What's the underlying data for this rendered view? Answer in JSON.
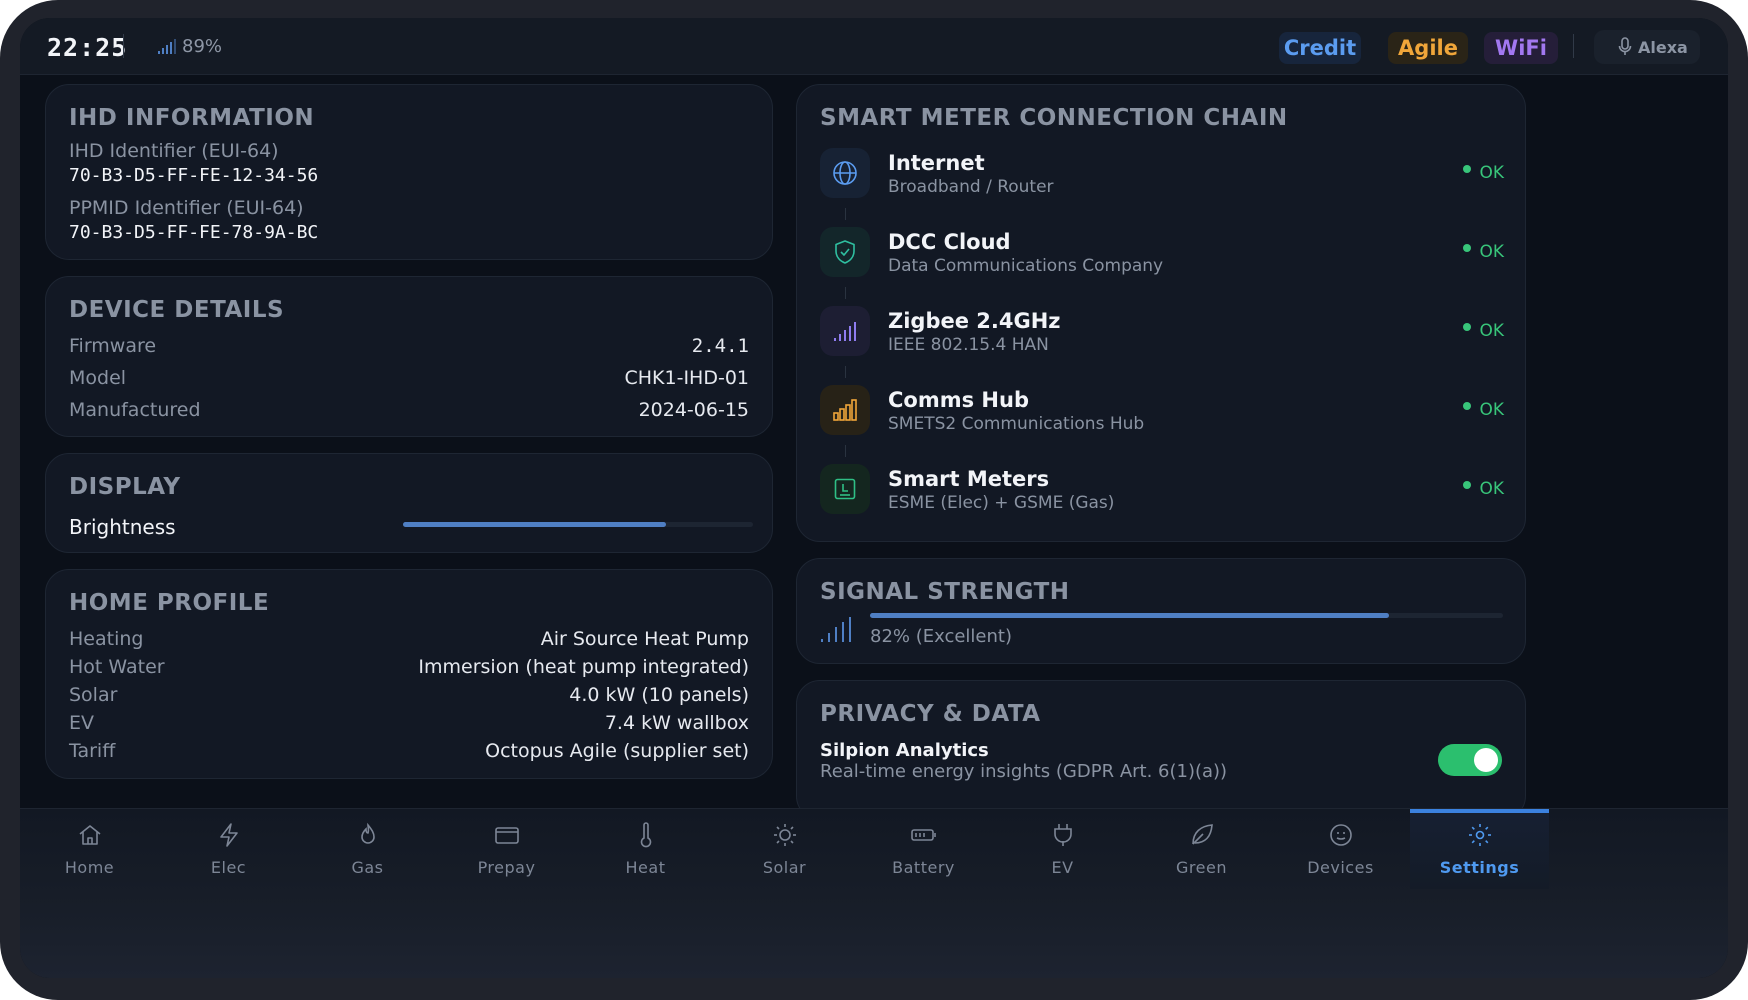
{
  "status_bar": {
    "time": "22:25",
    "battery": "89%",
    "pills": {
      "credit": "Credit",
      "agile": "Agile",
      "wifi": "WiFi"
    },
    "assistant": "Alexa"
  },
  "ihd_info": {
    "title": "IHD INFORMATION",
    "ihd_label": "IHD Identifier (EUI-64)",
    "ihd_value": "70-B3-D5-FF-FE-12-34-56",
    "ppmid_label": "PPMID Identifier (EUI-64)",
    "ppmid_value": "70-B3-D5-FF-FE-78-9A-BC"
  },
  "device_details": {
    "title": "DEVICE DETAILS",
    "rows": [
      {
        "label": "Firmware",
        "value": "2.4.1"
      },
      {
        "label": "Model",
        "value": "CHK1-IHD-01"
      },
      {
        "label": "Manufactured",
        "value": "2024-06-15"
      }
    ]
  },
  "display": {
    "title": "DISPLAY",
    "brightness_label": "Brightness",
    "brightness_level": 0.75
  },
  "home_profile": {
    "title": "HOME PROFILE",
    "rows": [
      {
        "label": "Heating",
        "value": "Air Source Heat Pump"
      },
      {
        "label": "Hot Water",
        "value": "Immersion (heat pump integrated)"
      },
      {
        "label": "Solar",
        "value": "4.0 kW (10 panels)"
      },
      {
        "label": "EV",
        "value": "7.4 kW wallbox"
      },
      {
        "label": "Tariff",
        "value": "Octopus Agile (supplier set)"
      }
    ]
  },
  "connection_chain": {
    "title": "SMART METER CONNECTION CHAIN",
    "items": [
      {
        "name": "Internet",
        "sub": "Broadband / Router",
        "status": "OK",
        "icon": "globe-icon",
        "color": "#5b9cf0"
      },
      {
        "name": "DCC Cloud",
        "sub": "Data Communications Company",
        "status": "OK",
        "icon": "shield-icon",
        "color": "#2fbfa0"
      },
      {
        "name": "Zigbee 2.4GHz",
        "sub": "IEEE 802.15.4 HAN",
        "status": "OK",
        "icon": "signal-bars-icon",
        "color": "#8f7cf0"
      },
      {
        "name": "Comms Hub",
        "sub": "SMETS2 Communications Hub",
        "status": "OK",
        "icon": "hub-bars-icon",
        "color": "#f0a63a"
      },
      {
        "name": "Smart Meters",
        "sub": "ESME (Elec) + GSME (Gas)",
        "status": "OK",
        "icon": "meter-icon",
        "color": "#2fbf85"
      }
    ]
  },
  "signal_strength": {
    "title": "SIGNAL STRENGTH",
    "text": "82% (Excellent)",
    "level": 0.82
  },
  "privacy": {
    "title": "PRIVACY & DATA",
    "name": "Silpion Analytics",
    "desc": "Real-time energy insights (GDPR Art. 6(1)(a))",
    "enabled": true
  },
  "bottom_nav": {
    "items": [
      {
        "label": "Home",
        "icon": "home-icon"
      },
      {
        "label": "Elec",
        "icon": "lightning-icon"
      },
      {
        "label": "Gas",
        "icon": "flame-icon"
      },
      {
        "label": "Prepay",
        "icon": "wallet-icon"
      },
      {
        "label": "Heat",
        "icon": "thermometer-icon"
      },
      {
        "label": "Solar",
        "icon": "sun-icon"
      },
      {
        "label": "Battery",
        "icon": "battery-icon"
      },
      {
        "label": "EV",
        "icon": "plug-icon"
      },
      {
        "label": "Green",
        "icon": "leaf-icon"
      },
      {
        "label": "Devices",
        "icon": "device-face-icon"
      },
      {
        "label": "Settings",
        "icon": "gear-icon"
      }
    ],
    "active": "Settings"
  },
  "colors": {
    "accent_blue": "#4f9af0",
    "ok_green": "#38c57a",
    "toggle_green": "#2bbf6e"
  }
}
